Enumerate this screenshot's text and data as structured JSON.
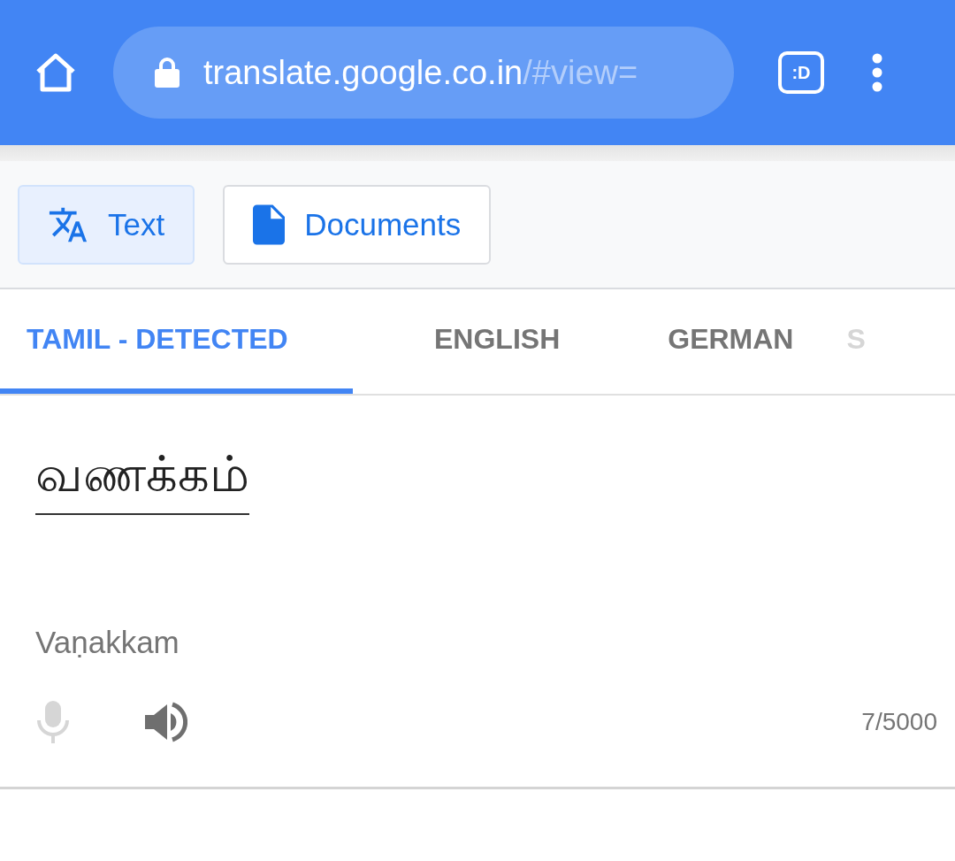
{
  "browser": {
    "url_domain": "translate.google.co.in",
    "url_path": "/#view=",
    "tab_badge": ":D"
  },
  "modes": [
    {
      "label": "Text",
      "kind": "translate",
      "selected": true
    },
    {
      "label": "Documents",
      "kind": "document",
      "selected": false
    }
  ],
  "languages": [
    {
      "label": "TAMIL - DETECTED",
      "selected": true,
      "faded": false
    },
    {
      "label": "ENGLISH",
      "selected": false,
      "faded": false
    },
    {
      "label": "GERMAN",
      "selected": false,
      "faded": false
    },
    {
      "label": "S",
      "selected": false,
      "faded": true
    }
  ],
  "source": {
    "text": "வணக்கம்",
    "transliteration": "Vaṇakkam",
    "mic_disabled": true,
    "char_count": "7/5000"
  }
}
